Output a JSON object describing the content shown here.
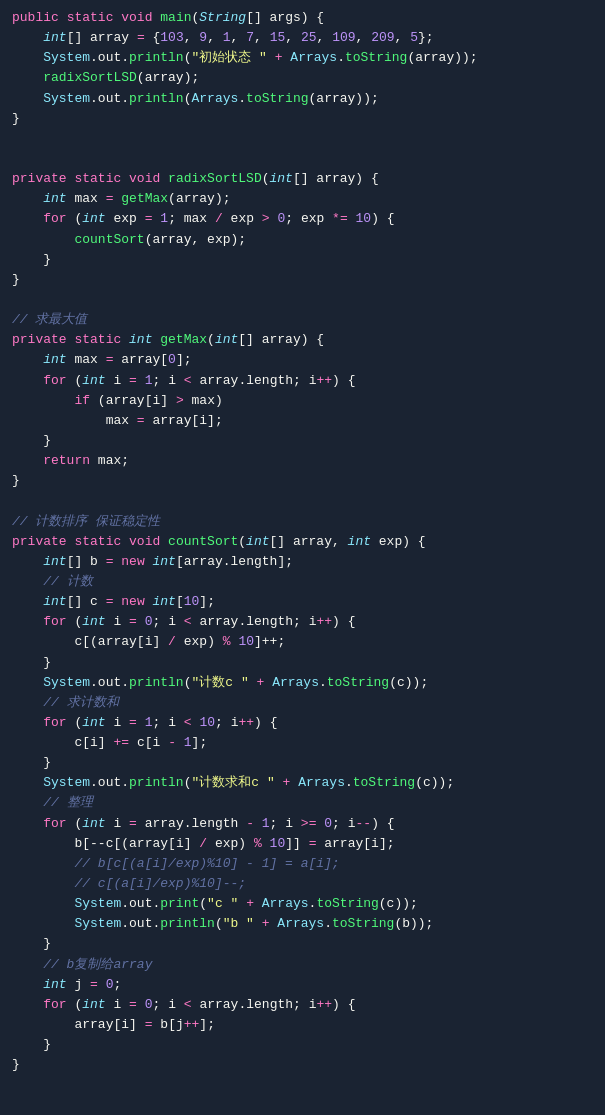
{
  "code": {
    "lines": [
      {
        "id": "l1",
        "content": "public static void main(String[] args) {"
      },
      {
        "id": "l2",
        "content": "    int[] array = {103, 9, 1, 7, 15, 25, 109, 209, 5};"
      },
      {
        "id": "l3",
        "content": "    System.out.println(\"初始状态 \" + Arrays.toString(array));"
      },
      {
        "id": "l4",
        "content": "    radixSortLSD(array);"
      },
      {
        "id": "l5",
        "content": "    System.out.println(Arrays.toString(array));"
      },
      {
        "id": "l6",
        "content": "}"
      },
      {
        "id": "l7",
        "content": ""
      },
      {
        "id": "l8",
        "content": ""
      },
      {
        "id": "l9",
        "content": "private static void radixSortLSD(int[] array) {"
      },
      {
        "id": "l10",
        "content": "    int max = getMax(array);"
      },
      {
        "id": "l11",
        "content": "    for (int exp = 1; max / exp > 0; exp *= 10) {"
      },
      {
        "id": "l12",
        "content": "        countSort(array, exp);"
      },
      {
        "id": "l13",
        "content": "    }"
      },
      {
        "id": "l14",
        "content": "}"
      },
      {
        "id": "l15",
        "content": ""
      },
      {
        "id": "l16",
        "content": "// 求最大值"
      },
      {
        "id": "l17",
        "content": "private static int getMax(int[] array) {"
      },
      {
        "id": "l18",
        "content": "    int max = array[0];"
      },
      {
        "id": "l19",
        "content": "    for (int i = 1; i < array.length; i++) {"
      },
      {
        "id": "l20",
        "content": "        if (array[i] > max)"
      },
      {
        "id": "l21",
        "content": "            max = array[i];"
      },
      {
        "id": "l22",
        "content": "    }"
      },
      {
        "id": "l23",
        "content": "    return max;"
      },
      {
        "id": "l24",
        "content": "}"
      },
      {
        "id": "l25",
        "content": ""
      },
      {
        "id": "l26",
        "content": "// 计数排序 保证稳定性"
      },
      {
        "id": "l27",
        "content": "private static void countSort(int[] array, int exp) {"
      },
      {
        "id": "l28",
        "content": "    int[] b = new int[array.length];"
      },
      {
        "id": "l29",
        "content": "    // 计数"
      },
      {
        "id": "l30",
        "content": "    int[] c = new int[10];"
      },
      {
        "id": "l31",
        "content": "    for (int i = 0; i < array.length; i++) {"
      },
      {
        "id": "l32",
        "content": "        c[(array[i] / exp) % 10]++;"
      },
      {
        "id": "l33",
        "content": "    }"
      },
      {
        "id": "l34",
        "content": "    System.out.println(\"计数c \" + Arrays.toString(c));"
      },
      {
        "id": "l35",
        "content": "    // 求计数和"
      },
      {
        "id": "l36",
        "content": "    for (int i = 1; i < 10; i++) {"
      },
      {
        "id": "l37",
        "content": "        c[i] += c[i - 1];"
      },
      {
        "id": "l38",
        "content": "    }"
      },
      {
        "id": "l39",
        "content": "    System.out.println(\"计数求和c \" + Arrays.toString(c));"
      },
      {
        "id": "l40",
        "content": "    // 整理"
      },
      {
        "id": "l41",
        "content": "    for (int i = array.length - 1; i >= 0; i--) {"
      },
      {
        "id": "l42",
        "content": "        b[--c[(array[i] / exp) % 10]] = array[i];"
      },
      {
        "id": "l43",
        "content": "        // b[c[(a[i]/exp)%10] - 1] = a[i];"
      },
      {
        "id": "l44",
        "content": "        // c[(a[i]/exp)%10]--;"
      },
      {
        "id": "l45",
        "content": "        System.out.print(\"c \" + Arrays.toString(c));"
      },
      {
        "id": "l46",
        "content": "        System.out.println(\"b \" + Arrays.toString(b));"
      },
      {
        "id": "l47",
        "content": "    }"
      },
      {
        "id": "l48",
        "content": "    // b复制给array"
      },
      {
        "id": "l49",
        "content": "    int j = 0;"
      },
      {
        "id": "l50",
        "content": "    for (int i = 0; i < array.length; i++) {"
      },
      {
        "id": "l51",
        "content": "        array[i] = b[j++];"
      },
      {
        "id": "l52",
        "content": "    }"
      },
      {
        "id": "l53",
        "content": "}"
      }
    ]
  }
}
